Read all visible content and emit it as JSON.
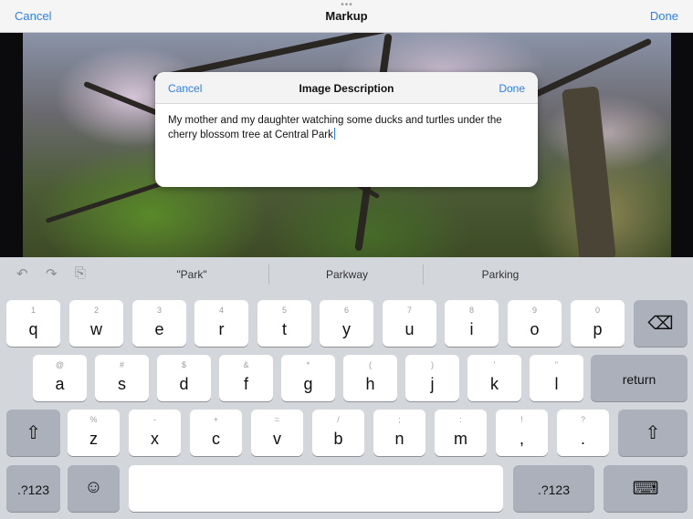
{
  "navbar": {
    "left": "Cancel",
    "title": "Markup",
    "right": "Done"
  },
  "dialog": {
    "cancel": "Cancel",
    "title": "Image Description",
    "done": "Done",
    "text": "My mother and my daughter watching some ducks and turtles under the cherry blossom tree at Central Park"
  },
  "suggestions": [
    "\"Park\"",
    "Parkway",
    "Parking"
  ],
  "icons": {
    "undo": "undo-icon",
    "redo": "redo-icon",
    "paste": "paste-icon",
    "delete": "delete-icon",
    "shift": "shift-icon",
    "emoji": "emoji-icon",
    "keyboard": "keyboard-dismiss-icon"
  },
  "keys": {
    "row1": [
      {
        "hint": "1",
        "main": "q"
      },
      {
        "hint": "2",
        "main": "w"
      },
      {
        "hint": "3",
        "main": "e"
      },
      {
        "hint": "4",
        "main": "r"
      },
      {
        "hint": "5",
        "main": "t"
      },
      {
        "hint": "6",
        "main": "y"
      },
      {
        "hint": "7",
        "main": "u"
      },
      {
        "hint": "8",
        "main": "i"
      },
      {
        "hint": "9",
        "main": "o"
      },
      {
        "hint": "0",
        "main": "p"
      }
    ],
    "row2": [
      {
        "hint": "@",
        "main": "a"
      },
      {
        "hint": "#",
        "main": "s"
      },
      {
        "hint": "$",
        "main": "d"
      },
      {
        "hint": "&",
        "main": "f"
      },
      {
        "hint": "*",
        "main": "g"
      },
      {
        "hint": "(",
        "main": "h"
      },
      {
        "hint": ")",
        "main": "j"
      },
      {
        "hint": "'",
        "main": "k"
      },
      {
        "hint": "\"",
        "main": "l"
      }
    ],
    "row3": [
      {
        "hint": "%",
        "main": "z"
      },
      {
        "hint": "-",
        "main": "x"
      },
      {
        "hint": "+",
        "main": "c"
      },
      {
        "hint": "=",
        "main": "v"
      },
      {
        "hint": "/",
        "main": "b"
      },
      {
        "hint": ";",
        "main": "n"
      },
      {
        "hint": ":",
        "main": "m"
      },
      {
        "hint": "!",
        "main": ","
      },
      {
        "hint": "?",
        "main": "."
      }
    ],
    "return": "return",
    "numbers": ".?123"
  }
}
